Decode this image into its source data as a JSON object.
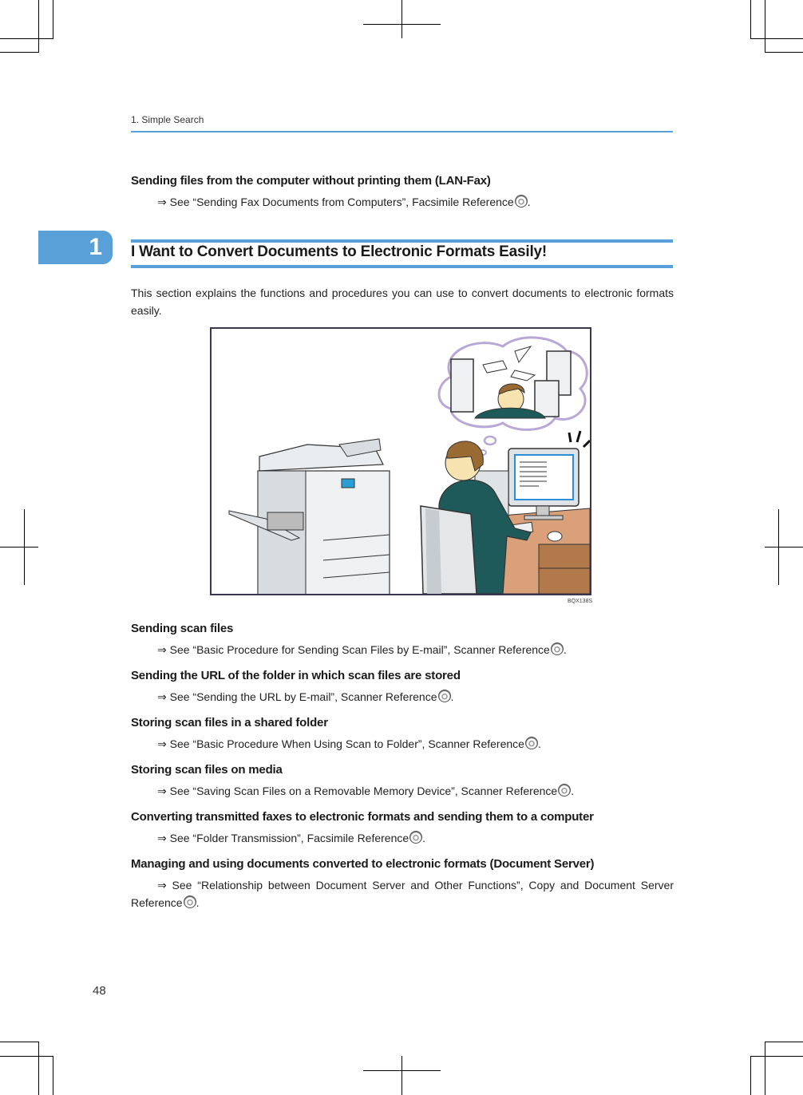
{
  "header": {
    "breadcrumb": "1. Simple Search"
  },
  "top_item": {
    "heading": "Sending files from the computer without printing them (LAN-Fax)",
    "reference": "⇒ See “Sending Fax Documents from Computers”, Facsimile Reference",
    "icon": "cd-rom-icon"
  },
  "chapter_tab": {
    "number": "1"
  },
  "section": {
    "title": "I Want to Convert Documents to Electronic Formats Easily!",
    "intro": "This section explains the functions and procedures you can use to convert documents to electronic formats easily."
  },
  "figure": {
    "code": "BQX138S",
    "description": "Illustration of a man at a desk computer next to a multifunction printer, thinking about stacks of servers and documents",
    "colors": {
      "border": "#3b3550",
      "suit": "#1e5a5a",
      "desk": "#d9a07a",
      "thought": "#b9a8d6",
      "screen_accent": "#2a8fd6"
    }
  },
  "items": [
    {
      "heading": "Sending scan files",
      "reference": "⇒ See “Basic Procedure for Sending Scan Files by E-mail”, Scanner Reference",
      "icon": "cd-rom-icon"
    },
    {
      "heading": "Sending the URL of the folder in which scan files are stored",
      "reference": "⇒ See “Sending the URL by E-mail”, Scanner Reference",
      "icon": "cd-rom-icon"
    },
    {
      "heading": "Storing scan files in a shared folder",
      "reference": "⇒ See “Basic Procedure When Using Scan to Folder”, Scanner Reference",
      "icon": "cd-rom-icon"
    },
    {
      "heading": "Storing scan files on media",
      "reference": "⇒ See “Saving Scan Files on a Removable Memory Device”, Scanner Reference",
      "icon": "cd-rom-icon"
    },
    {
      "heading": "Converting transmitted faxes to electronic formats and sending them to a computer",
      "reference": "⇒ See “Folder Transmission”, Facsimile Reference",
      "icon": "cd-rom-icon"
    },
    {
      "heading": "Managing and using documents converted to electronic formats (Document Server)",
      "reference": "⇒ See “Relationship between Document Server and Other Functions”, Copy and Document Server Reference",
      "icon": "cd-rom-icon"
    }
  ],
  "footer": {
    "page_number": "48"
  },
  "colors": {
    "accent": "#5aa0d8",
    "text": "#1a1a1a"
  }
}
